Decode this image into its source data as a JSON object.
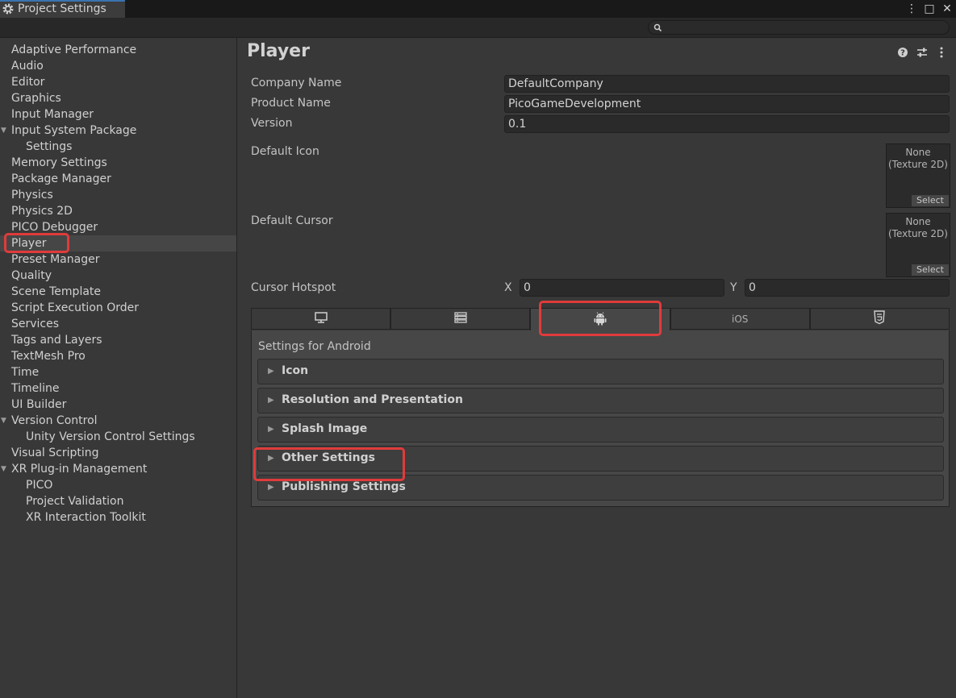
{
  "window": {
    "title": "Project Settings",
    "controls": [
      "⋮",
      "□",
      "✕"
    ]
  },
  "search": {
    "placeholder": ""
  },
  "sidebar": {
    "items": [
      {
        "label": "Adaptive Performance",
        "indent": 0
      },
      {
        "label": "Audio",
        "indent": 0
      },
      {
        "label": "Editor",
        "indent": 0
      },
      {
        "label": "Graphics",
        "indent": 0
      },
      {
        "label": "Input Manager",
        "indent": 0
      },
      {
        "label": "Input System Package",
        "indent": 0,
        "foldout": true
      },
      {
        "label": "Settings",
        "indent": 1
      },
      {
        "label": "Memory Settings",
        "indent": 0
      },
      {
        "label": "Package Manager",
        "indent": 0
      },
      {
        "label": "Physics",
        "indent": 0
      },
      {
        "label": "Physics 2D",
        "indent": 0
      },
      {
        "label": "PICO Debugger",
        "indent": 0
      },
      {
        "label": "Player",
        "indent": 0,
        "selected": true
      },
      {
        "label": "Preset Manager",
        "indent": 0
      },
      {
        "label": "Quality",
        "indent": 0
      },
      {
        "label": "Scene Template",
        "indent": 0
      },
      {
        "label": "Script Execution Order",
        "indent": 0
      },
      {
        "label": "Services",
        "indent": 0
      },
      {
        "label": "Tags and Layers",
        "indent": 0
      },
      {
        "label": "TextMesh Pro",
        "indent": 0
      },
      {
        "label": "Time",
        "indent": 0
      },
      {
        "label": "Timeline",
        "indent": 0
      },
      {
        "label": "UI Builder",
        "indent": 0
      },
      {
        "label": "Version Control",
        "indent": 0,
        "foldout": true
      },
      {
        "label": "Unity Version Control Settings",
        "indent": 1
      },
      {
        "label": "Visual Scripting",
        "indent": 0
      },
      {
        "label": "XR Plug-in Management",
        "indent": 0,
        "foldout": true
      },
      {
        "label": "PICO",
        "indent": 1
      },
      {
        "label": "Project Validation",
        "indent": 1
      },
      {
        "label": "XR Interaction Toolkit",
        "indent": 1
      }
    ]
  },
  "main": {
    "title": "Player",
    "header_icons": [
      "help-icon",
      "preset-icon",
      "kebab-menu-icon"
    ],
    "company_name": {
      "label": "Company Name",
      "value": "DefaultCompany"
    },
    "product_name": {
      "label": "Product Name",
      "value": "PicoGameDevelopment"
    },
    "version": {
      "label": "Version",
      "value": "0.1"
    },
    "default_icon": {
      "label": "Default Icon",
      "none": "None\n(Texture 2D)",
      "select": "Select"
    },
    "default_cursor": {
      "label": "Default Cursor",
      "none": "None\n(Texture 2D)",
      "select": "Select"
    },
    "cursor_hotspot": {
      "label": "Cursor Hotspot",
      "x_label": "X",
      "x_value": "0",
      "y_label": "Y",
      "y_value": "0"
    },
    "platform_tabs": [
      {
        "icon": "monitor-icon"
      },
      {
        "icon": "server-icon"
      },
      {
        "icon": "android-icon",
        "active": true
      },
      {
        "label": "iOS"
      },
      {
        "icon": "html5-icon"
      }
    ],
    "settings_title": "Settings for Android",
    "sections": [
      "Icon",
      "Resolution and Presentation",
      "Splash Image",
      "Other Settings",
      "Publishing Settings"
    ]
  },
  "colors": {
    "background": "#383838",
    "highlight": "#e03b3b",
    "accent": "#3a72b0"
  }
}
